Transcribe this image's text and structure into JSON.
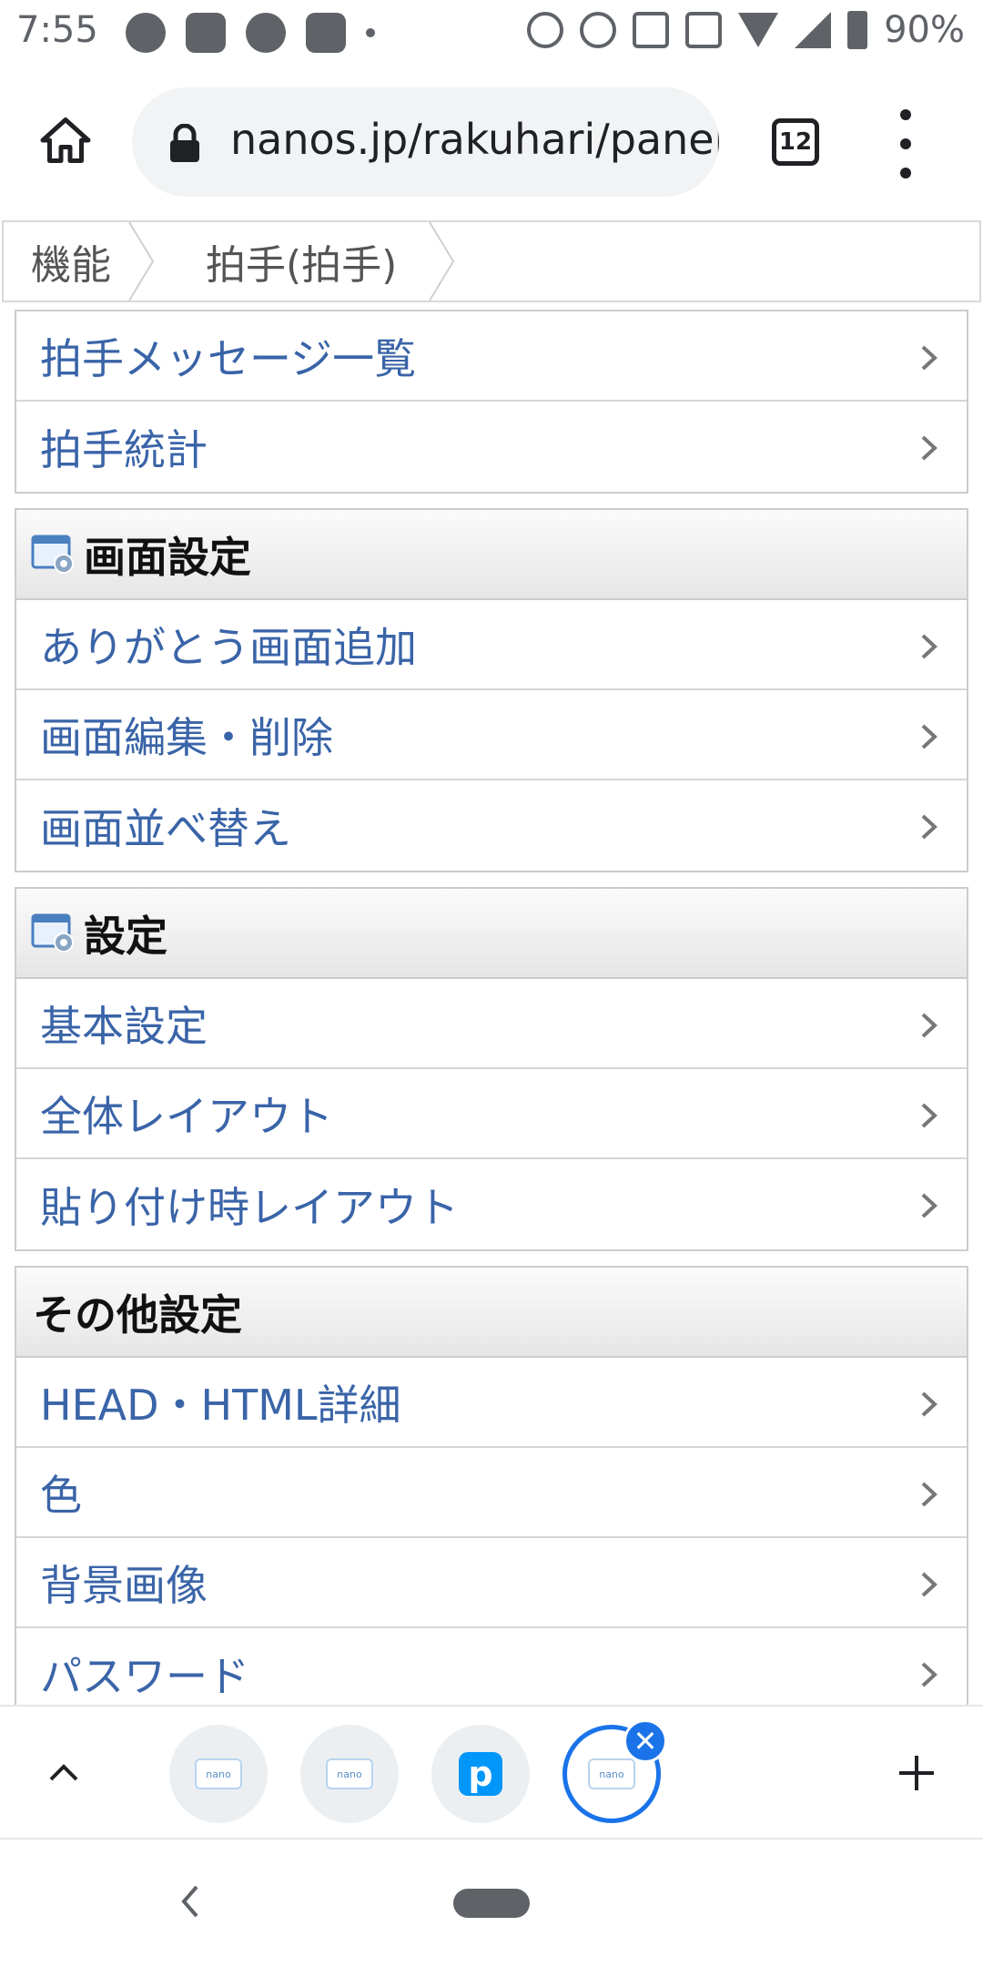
{
  "status_bar": {
    "time": "7:55",
    "battery": "90%"
  },
  "browser": {
    "url": "nanos.jp/rakuhari/panel/",
    "tab_count": "12"
  },
  "breadcrumb": [
    "機能",
    "拍手(拍手)"
  ],
  "groups": [
    {
      "header": null,
      "items": [
        "拍手メッセージ一覧",
        "拍手統計"
      ]
    },
    {
      "header": "画面設定",
      "header_icon": "settings-panel-icon",
      "items": [
        "ありがとう画面追加",
        "画面編集・削除",
        "画面並べ替え"
      ]
    },
    {
      "header": "設定",
      "header_icon": "settings-panel-icon",
      "items": [
        "基本設定",
        "全体レイアウト",
        "貼り付け時レイアウト"
      ]
    },
    {
      "header": "その他設定",
      "header_icon": null,
      "items": [
        "HEAD・HTML詳細",
        "色",
        "背景画像",
        "パスワード"
      ]
    }
  ],
  "tab_strip": {
    "favicons": [
      "nano",
      "nano",
      "p",
      "nano"
    ],
    "active_index": 3
  },
  "colors": {
    "link": "#3a64a8",
    "accent": "#1a73e8"
  }
}
